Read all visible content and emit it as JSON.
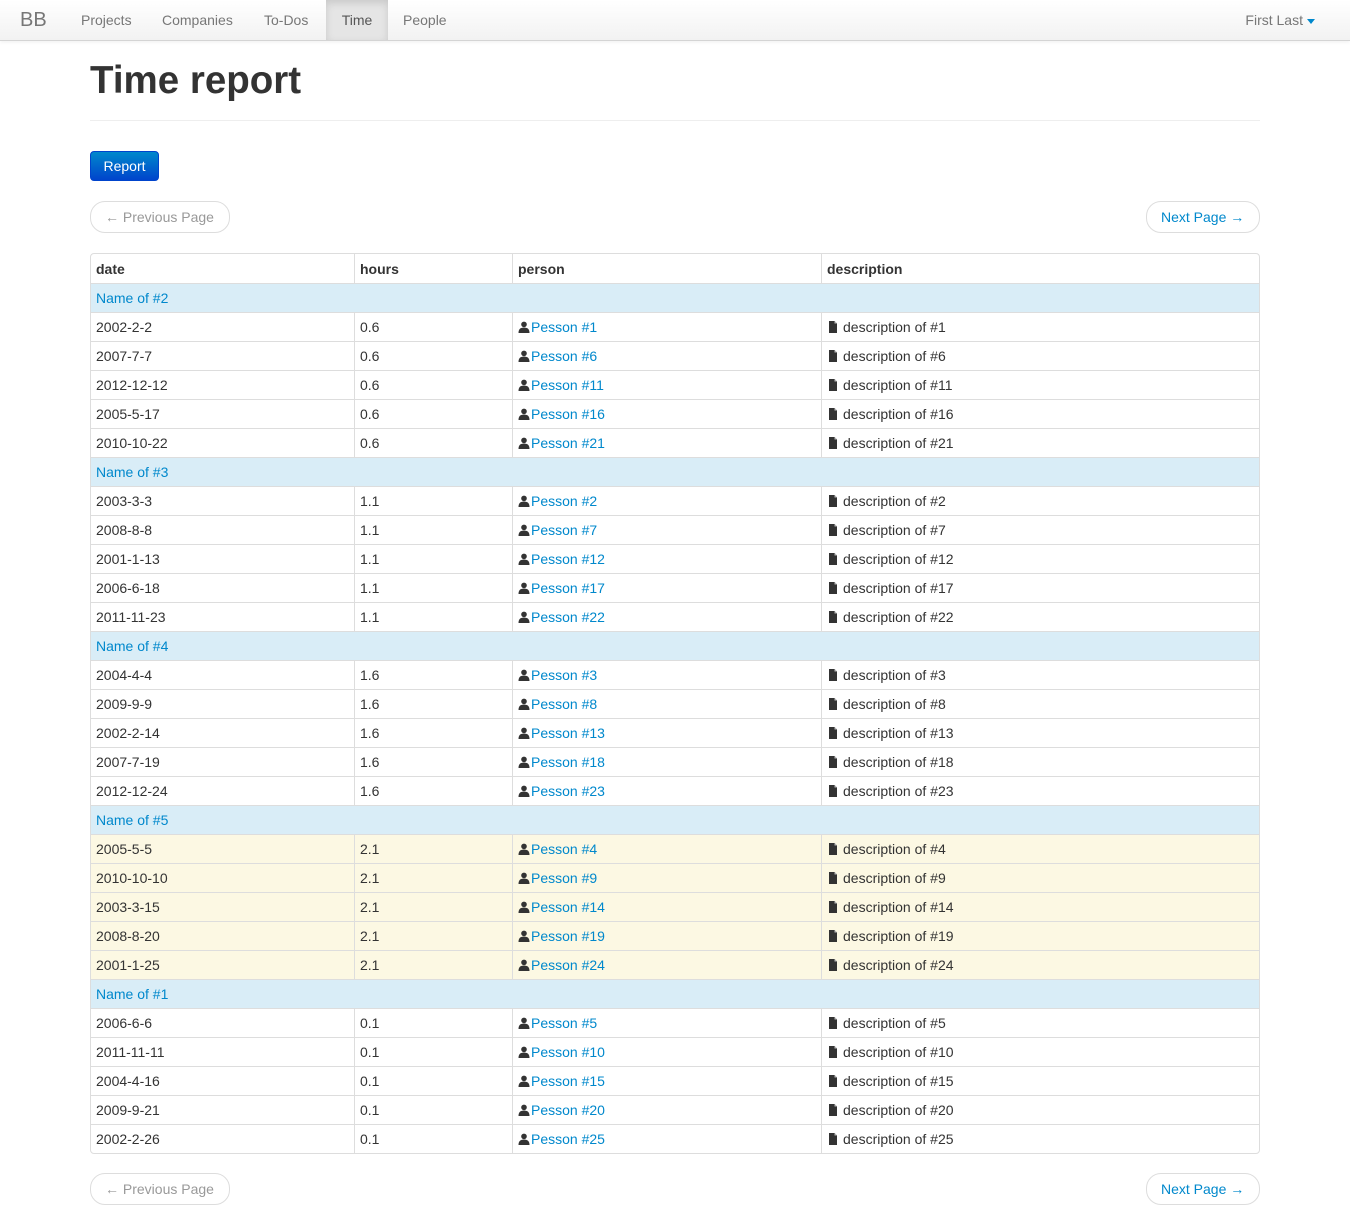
{
  "navbar": {
    "brand": "BB",
    "items": [
      {
        "label": "Projects",
        "active": false
      },
      {
        "label": "Companies",
        "active": false
      },
      {
        "label": "To-Dos",
        "active": false
      },
      {
        "label": "Time",
        "active": true
      },
      {
        "label": "People",
        "active": false
      }
    ],
    "user": "First Last"
  },
  "page": {
    "title": "Time report",
    "report_button": "Report"
  },
  "pager": {
    "previous": "← Previous Page",
    "next": "Next Page →"
  },
  "table": {
    "headers": [
      "date",
      "hours",
      "person",
      "description"
    ],
    "groups": [
      {
        "name": "Name of #2",
        "highlight": false,
        "rows": [
          {
            "date": "2002-2-2",
            "hours": "0.6",
            "person": "Pesson #1",
            "description": "description of #1"
          },
          {
            "date": "2007-7-7",
            "hours": "0.6",
            "person": "Pesson #6",
            "description": "description of #6"
          },
          {
            "date": "2012-12-12",
            "hours": "0.6",
            "person": "Pesson #11",
            "description": "description of #11"
          },
          {
            "date": "2005-5-17",
            "hours": "0.6",
            "person": "Pesson #16",
            "description": "description of #16"
          },
          {
            "date": "2010-10-22",
            "hours": "0.6",
            "person": "Pesson #21",
            "description": "description of #21"
          }
        ]
      },
      {
        "name": "Name of #3",
        "highlight": false,
        "rows": [
          {
            "date": "2003-3-3",
            "hours": "1.1",
            "person": "Pesson #2",
            "description": "description of #2"
          },
          {
            "date": "2008-8-8",
            "hours": "1.1",
            "person": "Pesson #7",
            "description": "description of #7"
          },
          {
            "date": "2001-1-13",
            "hours": "1.1",
            "person": "Pesson #12",
            "description": "description of #12"
          },
          {
            "date": "2006-6-18",
            "hours": "1.1",
            "person": "Pesson #17",
            "description": "description of #17"
          },
          {
            "date": "2011-11-23",
            "hours": "1.1",
            "person": "Pesson #22",
            "description": "description of #22"
          }
        ]
      },
      {
        "name": "Name of #4",
        "highlight": false,
        "rows": [
          {
            "date": "2004-4-4",
            "hours": "1.6",
            "person": "Pesson #3",
            "description": "description of #3"
          },
          {
            "date": "2009-9-9",
            "hours": "1.6",
            "person": "Pesson #8",
            "description": "description of #8"
          },
          {
            "date": "2002-2-14",
            "hours": "1.6",
            "person": "Pesson #13",
            "description": "description of #13"
          },
          {
            "date": "2007-7-19",
            "hours": "1.6",
            "person": "Pesson #18",
            "description": "description of #18"
          },
          {
            "date": "2012-12-24",
            "hours": "1.6",
            "person": "Pesson #23",
            "description": "description of #23"
          }
        ]
      },
      {
        "name": "Name of #5",
        "highlight": true,
        "rows": [
          {
            "date": "2005-5-5",
            "hours": "2.1",
            "person": "Pesson #4",
            "description": "description of #4"
          },
          {
            "date": "2010-10-10",
            "hours": "2.1",
            "person": "Pesson #9",
            "description": "description of #9"
          },
          {
            "date": "2003-3-15",
            "hours": "2.1",
            "person": "Pesson #14",
            "description": "description of #14"
          },
          {
            "date": "2008-8-20",
            "hours": "2.1",
            "person": "Pesson #19",
            "description": "description of #19"
          },
          {
            "date": "2001-1-25",
            "hours": "2.1",
            "person": "Pesson #24",
            "description": "description of #24"
          }
        ]
      },
      {
        "name": "Name of #1",
        "highlight": false,
        "rows": [
          {
            "date": "2006-6-6",
            "hours": "0.1",
            "person": "Pesson #5",
            "description": "description of #5"
          },
          {
            "date": "2011-11-11",
            "hours": "0.1",
            "person": "Pesson #10",
            "description": "description of #10"
          },
          {
            "date": "2004-4-16",
            "hours": "0.1",
            "person": "Pesson #15",
            "description": "description of #15"
          },
          {
            "date": "2009-9-21",
            "hours": "0.1",
            "person": "Pesson #20",
            "description": "description of #20"
          },
          {
            "date": "2002-2-26",
            "hours": "0.1",
            "person": "Pesson #25",
            "description": "description of #25"
          }
        ]
      }
    ]
  },
  "icons": {
    "person": "user-icon",
    "description": "file-icon",
    "user_menu": "caret-down-icon"
  },
  "colors": {
    "link": "#0088cc",
    "group_row": "#d9edf7",
    "highlight_row": "#fcf8e3",
    "primary_button": "#0088cc"
  }
}
